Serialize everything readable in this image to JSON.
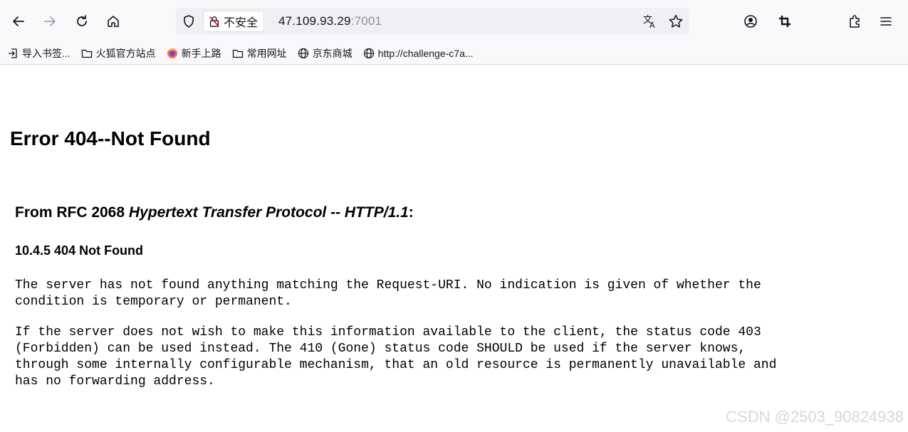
{
  "browser": {
    "security_label": "不安全",
    "url_host": "47.109.93.29",
    "url_port": ":7001",
    "icons": [
      "back-icon",
      "forward-icon",
      "reload-icon",
      "home-icon",
      "shield-icon",
      "insecure-lock-icon",
      "translate-icon",
      "bookmark-star-icon",
      "account-icon",
      "crop-icon",
      "extensions-icon",
      "menu-icon"
    ]
  },
  "bookmarks": [
    {
      "label": "导入书签...",
      "icon": "import-icon"
    },
    {
      "label": "火狐官方站点",
      "icon": "folder-icon"
    },
    {
      "label": "新手上路",
      "icon": "firefox-icon"
    },
    {
      "label": "常用网址",
      "icon": "folder-icon"
    },
    {
      "label": "京东商城",
      "icon": "globe-icon"
    },
    {
      "label": "http://challenge-c7a...",
      "icon": "globe-icon"
    }
  ],
  "page": {
    "error_title": "Error 404--Not Found",
    "rfc_prefix": "From RFC 2068 ",
    "rfc_italic": "Hypertext Transfer Protocol -- HTTP/1.1",
    "rfc_suffix": ":",
    "section_title": "10.4.5 404 Not Found",
    "paragraph1": "The server has not found anything matching the Request-URI. No indication is given of whether the\ncondition is temporary or permanent.",
    "paragraph2": "If the server does not wish to make this information available to the client, the status code 403\n(Forbidden) can be used instead. The 410 (Gone) status code SHOULD be used if the server knows,\nthrough some internally configurable mechanism, that an old resource is permanently unavailable and\nhas no forwarding address."
  },
  "watermark": "CSDN @2503_90824938"
}
